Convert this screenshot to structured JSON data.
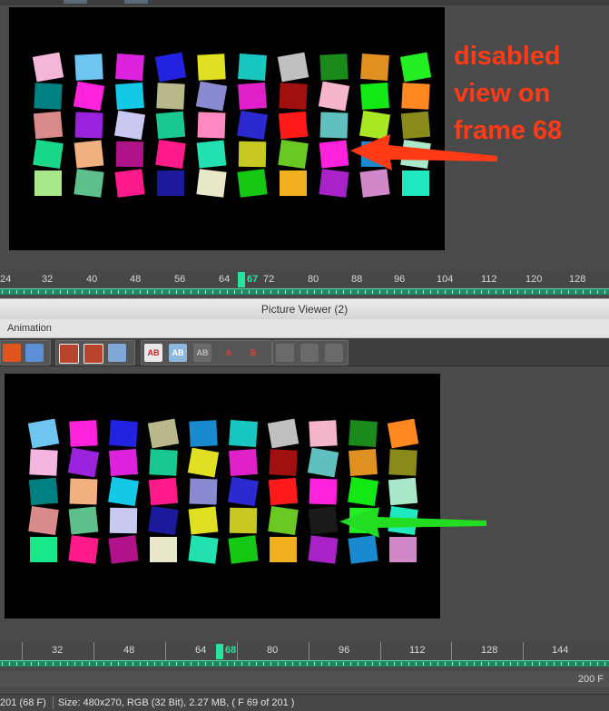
{
  "window": {
    "title": "Picture Viewer (2)"
  },
  "menu": {
    "items": [
      "Animation"
    ]
  },
  "annotation": {
    "text_lines": [
      "disabled",
      "view on",
      "frame 68"
    ],
    "color": "#ff3a17"
  },
  "top_ruler": {
    "ticks": [
      "24",
      "32",
      "40",
      "48",
      "56",
      "64",
      "67",
      "72",
      "80",
      "88",
      "96",
      "104",
      "112",
      "120",
      "128"
    ],
    "current_frame": "67"
  },
  "bottom_ruler": {
    "ticks": [
      "32",
      "48",
      "64",
      "68",
      "80",
      "96",
      "112",
      "128",
      "144"
    ],
    "current_frame": "68"
  },
  "frame_total": "200 F",
  "status": {
    "left": "201 (68 F)",
    "right": "Size: 480x270, RGB (32 Bit), 2.27 MB,  ( F 69 of 201 )"
  },
  "toolbar": {
    "buttons": [
      {
        "name": "ab-compare-button",
        "label": "AB"
      },
      {
        "name": "ab-split-button",
        "label": "AB"
      },
      {
        "name": "ab-overlay-button",
        "label": "AB"
      },
      {
        "name": "set-a-button",
        "label": "A"
      },
      {
        "name": "set-b-button",
        "label": "B"
      }
    ]
  },
  "colors": {
    "accent": "#27e39c",
    "arrow_red": "#ff3a17",
    "arrow_green": "#22dd22"
  }
}
